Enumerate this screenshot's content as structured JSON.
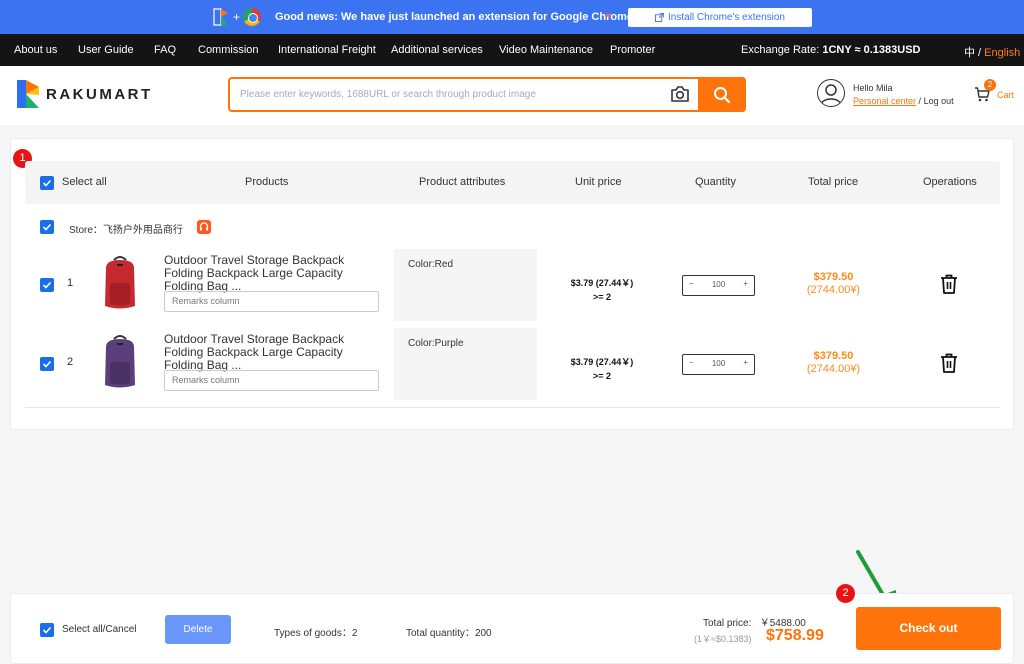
{
  "banner": {
    "news": "Good news: We have just launched an extension for Google Chrome",
    "install_label": "Install Chrome's extension"
  },
  "nav": {
    "items": [
      "About us",
      "User Guide",
      "FAQ",
      "Commission",
      "International Freight",
      "Additional services",
      "Video Maintenance",
      "Promoter"
    ],
    "rate_label": "Exchange Rate:",
    "rate_value": "1CNY ≈ 0.1383USD",
    "lang_cn": "中",
    "lang_sep": " / ",
    "lang_en": "English"
  },
  "header": {
    "logo_text": "RAKUMART",
    "search_placeholder": "Please enter keywords, 1688URL or search through product image",
    "hello": "Hello Mila",
    "personal_center": "Personal center",
    "logout_sep": " / ",
    "logout": "Log out",
    "cart_count": "2",
    "cart_label": "Cart"
  },
  "annotations": {
    "step1": "1",
    "step2": "2"
  },
  "cart": {
    "columns": {
      "select_all": "Select all",
      "products": "Products",
      "attributes": "Product attributes",
      "unit_price": "Unit price",
      "quantity": "Quantity",
      "total_price": "Total price",
      "operations": "Operations"
    },
    "store_label": "Store：飞扬户外用品商行",
    "rows": [
      {
        "index": "1",
        "title": "Outdoor Travel Storage Backpack Folding Backpack Large Capacity Folding Bag ...",
        "remark_placeholder": "Remarks column",
        "attribute": "Color:Red",
        "unit_price": "$3.79 (27.44￥)",
        "min_qty": ">= 2",
        "minus": "−",
        "qty": "100",
        "plus": "+",
        "total_usd": "$379.50",
        "total_cny": "(2744.00¥)",
        "color": "#c62a30"
      },
      {
        "index": "2",
        "title": "Outdoor Travel Storage Backpack Folding Backpack Large Capacity Folding Bag ...",
        "remark_placeholder": "Remarks column",
        "attribute": "Color:Purple",
        "unit_price": "$3.79 (27.44￥)",
        "min_qty": ">= 2",
        "minus": "−",
        "qty": "100",
        "plus": "+",
        "total_usd": "$379.50",
        "total_cny": "(2744.00¥)",
        "color": "#5b3f7a"
      }
    ]
  },
  "footer": {
    "select_all_cancel": "Select all/Cancel",
    "delete": "Delete",
    "types_label": "Types of goods：",
    "types_value": "2",
    "qty_label": "Total quantity：",
    "qty_value": "200",
    "total_label": "Total price:",
    "total_cny": "￥5488.00",
    "rate": "(1￥≈$0.1383)",
    "total_usd": "$758.99",
    "checkout": "Check out"
  },
  "colors": {
    "accent": "#ff730b",
    "blue": "#1a6fe8",
    "banner": "#3b73f1",
    "badge": "#e81414",
    "arrow": "#1e9e3a"
  }
}
